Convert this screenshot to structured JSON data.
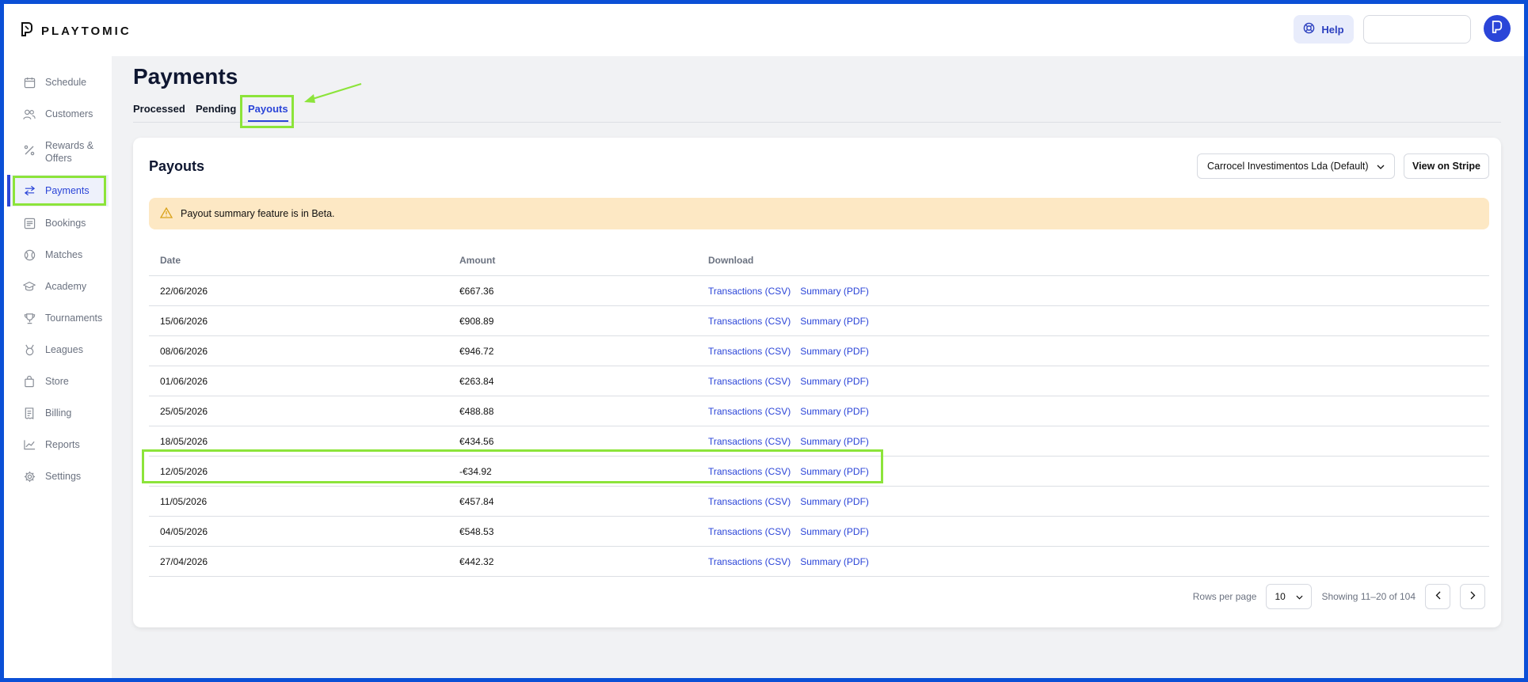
{
  "brand": {
    "name": "PLAYTOMIC",
    "logo_icon": "playtomic-logo-icon"
  },
  "header": {
    "help_label": "Help",
    "help_icon": "lifebuoy-icon",
    "search_value": "",
    "avatar_icon": "playtomic-avatar-icon"
  },
  "sidebar": {
    "items": [
      {
        "label": "Schedule",
        "icon": "calendar-icon"
      },
      {
        "label": "Customers",
        "icon": "users-icon"
      },
      {
        "label": "Rewards &\nOffers",
        "icon": "percent-icon"
      },
      {
        "label": "Payments",
        "icon": "arrows-exchange-icon",
        "active": true
      },
      {
        "label": "Bookings",
        "icon": "list-icon"
      },
      {
        "label": "Matches",
        "icon": "ball-icon"
      },
      {
        "label": "Academy",
        "icon": "graduation-cap-icon"
      },
      {
        "label": "Tournaments",
        "icon": "trophy-icon"
      },
      {
        "label": "Leagues",
        "icon": "medal-icon"
      },
      {
        "label": "Store",
        "icon": "bag-icon"
      },
      {
        "label": "Billing",
        "icon": "receipt-icon"
      },
      {
        "label": "Reports",
        "icon": "chart-line-icon"
      },
      {
        "label": "Settings",
        "icon": "gear-icon"
      }
    ]
  },
  "page": {
    "title": "Payments",
    "tabs": [
      {
        "label": "Processed"
      },
      {
        "label": "Pending"
      },
      {
        "label": "Payouts",
        "active": true
      }
    ]
  },
  "payouts": {
    "title": "Payouts",
    "account_select": "Carrocel Investimentos Lda (Default)",
    "view_stripe_label": "View on Stripe",
    "alert_text": "Payout summary feature is in Beta.",
    "columns": {
      "date": "Date",
      "amount": "Amount",
      "download": "Download"
    },
    "rows": [
      {
        "date": "22/06/2026",
        "amount": "€667.36",
        "csv": "Transactions (CSV)",
        "pdf": "Summary (PDF)"
      },
      {
        "date": "15/06/2026",
        "amount": "€908.89",
        "csv": "Transactions (CSV)",
        "pdf": "Summary (PDF)"
      },
      {
        "date": "08/06/2026",
        "amount": "€946.72",
        "csv": "Transactions (CSV)",
        "pdf": "Summary (PDF)"
      },
      {
        "date": "01/06/2026",
        "amount": "€263.84",
        "csv": "Transactions (CSV)",
        "pdf": "Summary (PDF)"
      },
      {
        "date": "25/05/2026",
        "amount": "€488.88",
        "csv": "Transactions (CSV)",
        "pdf": "Summary (PDF)"
      },
      {
        "date": "18/05/2026",
        "amount": "€434.56",
        "csv": "Transactions (CSV)",
        "pdf": "Summary (PDF)"
      },
      {
        "date": "12/05/2026",
        "amount": "-€34.92",
        "csv": "Transactions (CSV)",
        "pdf": "Summary (PDF)",
        "highlighted": true
      },
      {
        "date": "11/05/2026",
        "amount": "€457.84",
        "csv": "Transactions (CSV)",
        "pdf": "Summary (PDF)"
      },
      {
        "date": "04/05/2026",
        "amount": "€548.53",
        "csv": "Transactions (CSV)",
        "pdf": "Summary (PDF)"
      },
      {
        "date": "27/04/2026",
        "amount": "€442.32",
        "csv": "Transactions (CSV)",
        "pdf": "Summary (PDF)"
      }
    ],
    "pagination": {
      "rows_per_page_label": "Rows per page",
      "rows_per_page_value": "10",
      "showing_text": "Showing 11–20 of 104"
    }
  },
  "colors": {
    "accent": "#2b45d8",
    "highlight": "#8ce43a",
    "frame": "#0b4fd6",
    "alert_bg": "#fde8c4"
  }
}
